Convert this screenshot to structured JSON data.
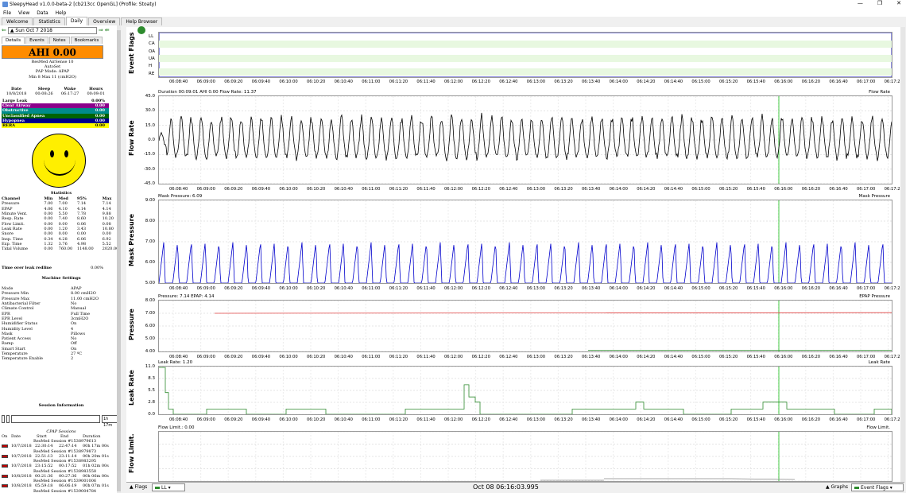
{
  "window": {
    "title": "SleepyHead v1.0.0-beta-2 [cb213cc OpenGL] (Profile: Stoaty)",
    "buttons": [
      "—",
      "❐",
      "✕"
    ]
  },
  "menu": [
    "File",
    "View",
    "Data",
    "Help"
  ],
  "tabs": [
    "Welcome",
    "Statistics",
    "Daily",
    "Overview",
    "Help Browser"
  ],
  "left": {
    "date": "Sun Oct 7 2018",
    "subtabs": [
      "Details",
      "Events",
      "Notes",
      "Bookmarks"
    ],
    "ahi": "AHI 0.00",
    "machine": [
      "ResMed AirSense 10",
      "AutoSet",
      "PAP Mode: APAP",
      "Min 8 Max 11 (cmH2O)"
    ],
    "dw_headers": [
      "Date",
      "Sleep",
      "Wake",
      "Hours"
    ],
    "dw_values": [
      "10/8/2018",
      "00:08:26",
      "06:17:27",
      "00:09:01"
    ],
    "events": [
      {
        "label": "Large Leak",
        "value": "0.00%",
        "bg": "#ffffff",
        "fg": "#000000"
      },
      {
        "label": "Clear Airway",
        "value": "0.00",
        "bg": "#8b008b",
        "fg": "#ffffff"
      },
      {
        "label": "Obstructive",
        "value": "0.00",
        "bg": "#008b8b",
        "fg": "#ffffff"
      },
      {
        "label": "Unclassified Apnea",
        "value": "0.00",
        "bg": "#006400",
        "fg": "#ffffff"
      },
      {
        "label": "Hypopnea",
        "value": "0.00",
        "bg": "#00008b",
        "fg": "#ffffff"
      },
      {
        "label": "RERA",
        "value": "0.00",
        "bg": "#ffff00",
        "fg": "#000000"
      }
    ],
    "stats_title": "Statistics",
    "stats_headers": [
      "Channel",
      "Min",
      "Med",
      "95%",
      "Max"
    ],
    "stats_rows": [
      [
        "Pressure",
        "7.00",
        "7.00",
        "7.14",
        "7.14"
      ],
      [
        "EPAP",
        "4.06",
        "4.10",
        "4.14",
        "4.14"
      ],
      [
        "Minute Vent.",
        "0.00",
        "5.50",
        "7.78",
        "9.88"
      ],
      [
        "Resp. Rate",
        "0.00",
        "7.40",
        "8.60",
        "10.20"
      ],
      [
        "Flow Limit.",
        "0.00",
        "0.00",
        "0.06",
        "0.08"
      ],
      [
        "Leak Rate",
        "0.00",
        "1.20",
        "3.43",
        "10.80"
      ],
      [
        "Snore",
        "0.00",
        "0.00",
        "0.00",
        "0.00"
      ],
      [
        "Insp. Time",
        "0.34",
        "4.28",
        "6.06",
        "6.92"
      ],
      [
        "Exp. Time",
        "1.32",
        "3.76",
        "4.98",
        "5.52"
      ],
      [
        "Tidal Volume",
        "0.00",
        "760.00",
        "1148.00",
        "2020.00"
      ]
    ],
    "time_over_label": "Time over leak redline",
    "time_over_value": "0.00%",
    "settings_title": "Machine Settings",
    "settings": [
      [
        "Mode",
        "APAP"
      ],
      [
        "Pressure Min",
        "8.00 cmH2O"
      ],
      [
        "Pressure Max",
        "11.00 cmH2O"
      ],
      [
        "Antibacterial Filter",
        "No"
      ],
      [
        "Climate Control",
        "Manual"
      ],
      [
        "EPR",
        "Full Time"
      ],
      [
        "EPR Level",
        "3cmH2O"
      ],
      [
        "Humidifier Status",
        "On"
      ],
      [
        "Humidity Level",
        "4"
      ],
      [
        "Mask",
        "Pillows"
      ],
      [
        "Patient Access",
        "No"
      ],
      [
        "Ramp",
        "Off"
      ],
      [
        "Smart Start",
        "On"
      ],
      [
        "Temperature",
        "27 ºC"
      ],
      [
        "Temperature Enable",
        "2"
      ]
    ],
    "session_title": "Session Information",
    "session_time": "1h 17m",
    "sessions_caption": "CPAP Sessions",
    "sessions_headers": [
      "On",
      "Date",
      "Start",
      "End",
      "Duration"
    ],
    "sessions": [
      {
        "name": "ResMed Session #1538979613",
        "date": "10/7/2018",
        "start": "22:30:14",
        "end": "22:47:14",
        "dur": "00h 17m 00s",
        "on": false
      },
      {
        "name": "ResMed Session #1538979873",
        "date": "10/7/2018",
        "start": "22:51:13",
        "end": "23:11:14",
        "dur": "00h 20m 01s",
        "on": false
      },
      {
        "name": "ResMed Session #1538983295",
        "date": "10/7/2018",
        "start": "23:15:52",
        "end": "00:17:52",
        "dur": "01h 02m 00s",
        "on": false
      },
      {
        "name": "ResMed Session #1538983558",
        "date": "10/8/2018",
        "start": "00:21:36",
        "end": "00:27:36",
        "dur": "00h 06m 00s",
        "on": false
      },
      {
        "name": "ResMed Session #1539001006",
        "date": "10/8/2018",
        "start": "05:59:18",
        "end": "06:06:19",
        "dur": "00h 07m 01s",
        "on": false
      },
      {
        "name": "ResMed Session #1539004784",
        "date": "10/8/2018",
        "start": "06:08:26",
        "end": "06:17:27",
        "dur": "00h 09m 01s",
        "on": true
      }
    ]
  },
  "graphs": {
    "xticks": [
      "06:08:40",
      "06:09:00",
      "06:09:20",
      "06:09:40",
      "06:10:00",
      "06:10:20",
      "06:10:40",
      "06:11:00",
      "06:11:20",
      "06:11:40",
      "06:12:00",
      "06:12:20",
      "06:12:40",
      "06:13:00",
      "06:13:20",
      "06:13:40",
      "06:14:00",
      "06:14:20",
      "06:14:40",
      "06:15:00",
      "06:15:20",
      "06:15:40",
      "06:16:00",
      "06:16:20",
      "06:16:40",
      "06:17:00",
      "06:17:20"
    ],
    "event_flags": {
      "title": "Event Flags",
      "rows": [
        "LL",
        "CA",
        "OA",
        "UA",
        "H",
        "RE"
      ]
    },
    "flow": {
      "title": "Flow Rate",
      "info": "Duration 00:09:01 AHI 0.00 Flow Rate: 11.37",
      "legend": "Flow Rate",
      "yticks": [
        "45.0",
        "30.0",
        "15.0",
        "0.0",
        "-15.0",
        "-30.0",
        "-45.0"
      ],
      "color": "#000000"
    },
    "mask": {
      "title": "Mask Pressure",
      "info": "Mask Pressure: 6.09",
      "legend": "Mask Pressure",
      "yticks": [
        "9.00",
        "8.00",
        "7.00",
        "6.00",
        "5.00"
      ],
      "color": "#0000cc"
    },
    "pressure": {
      "title": "Pressure",
      "info": "Pressure: 7.14 EPAP: 4.14",
      "legend": "EPAP Pressure",
      "yticks": [
        "8.00",
        "7.00",
        "6.00",
        "5.00",
        "4.00"
      ],
      "color": "#e04040"
    },
    "leak": {
      "title": "Leak Rate",
      "info": "Leak Rate: 1.20",
      "legend": "Leak Rate",
      "yticks": [
        "11.0",
        "8.3",
        "5.5",
        "2.8",
        "0.0"
      ],
      "color": "#2e8b2e"
    },
    "flowlim": {
      "title": "Flow Limit.",
      "info": "Flow Limit.: 0.00",
      "legend": "Flow Limit.",
      "yticks": [],
      "color": "#888888"
    }
  },
  "chart_data": [
    {
      "type": "line",
      "title": "Flow Rate",
      "ylabel": "Flow Rate",
      "ylim": [
        -45,
        45
      ],
      "grid": true,
      "legend": "top-right",
      "x_range": [
        "06:08:26",
        "06:17:27"
      ],
      "series": [
        {
          "name": "Flow Rate",
          "pattern": "periodic breathing, ~±22 amplitude, ~6s period"
        }
      ]
    },
    {
      "type": "line",
      "title": "Mask Pressure",
      "ylabel": "Mask Pressure",
      "ylim": [
        5,
        9
      ],
      "grid": true,
      "legend": "top-right",
      "series": [
        {
          "name": "Mask Pressure",
          "pattern": "peaks ~7.0, troughs ~5.0"
        }
      ]
    },
    {
      "type": "line",
      "title": "Pressure",
      "ylabel": "Pressure",
      "ylim": [
        4,
        8
      ],
      "grid": true,
      "legend": "top-right",
      "series": [
        {
          "name": "Pressure",
          "values_const": 7.0
        },
        {
          "name": "EPAP",
          "values_const": 4.1
        }
      ]
    },
    {
      "type": "line",
      "title": "Leak Rate",
      "ylabel": "Leak Rate",
      "ylim": [
        0,
        11
      ],
      "grid": true,
      "legend": "top-right",
      "series": [
        {
          "name": "Leak Rate",
          "x": [
            "06:08:26",
            "06:08:30",
            "06:08:34",
            "06:08:40",
            "06:09:10",
            "06:09:40",
            "06:10:10",
            "06:10:40",
            "06:11:10",
            "06:11:40",
            "06:12:06",
            "06:12:14",
            "06:12:22",
            "06:12:40",
            "06:13:10",
            "06:13:40",
            "06:14:10",
            "06:14:40",
            "06:15:10",
            "06:15:40",
            "06:16:10",
            "06:16:40",
            "06:17:10"
          ],
          "values": [
            10.8,
            5.0,
            1.2,
            0.0,
            1.2,
            0.0,
            1.2,
            0.0,
            0.0,
            1.2,
            6.8,
            2.8,
            0.0,
            0.0,
            1.2,
            1.2,
            0.0,
            1.2,
            0.0,
            1.2,
            0.0,
            1.2,
            0.0
          ]
        }
      ]
    },
    {
      "type": "line",
      "title": "Flow Limit.",
      "ylabel": "Flow Limit.",
      "series": [
        {
          "name": "Flow Limit.",
          "values_const": 0.0
        }
      ]
    }
  ],
  "bottom": {
    "flags": "Flags",
    "ll": "LL",
    "timestamp": "Oct 08 06:16:03.995",
    "graphs": "Graphs",
    "evflags": "Event Flags"
  }
}
